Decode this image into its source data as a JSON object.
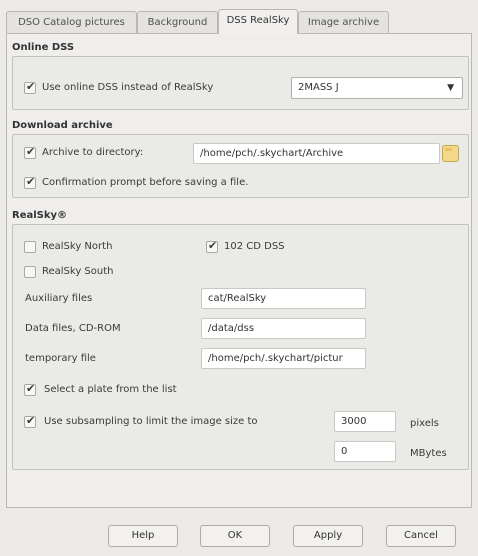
{
  "tabs": [
    {
      "label": "DSO Catalog pictures"
    },
    {
      "label": "Background"
    },
    {
      "label": "DSS RealSky"
    },
    {
      "label": "Image archive"
    }
  ],
  "online_dss": {
    "title": "Online DSS",
    "use_online_label": "Use online DSS instead of RealSky",
    "use_online_checked": true,
    "survey_selected": "2MASS J"
  },
  "download_archive": {
    "title": "Download archive",
    "archive_label": "Archive to directory:",
    "archive_checked": true,
    "archive_path": "/home/pch/.skychart/Archive",
    "confirm_label": "Confirmation prompt before saving a file.",
    "confirm_checked": true
  },
  "realsky": {
    "title": "RealSky®",
    "north_label": "RealSky North",
    "north_checked": false,
    "south_label": "RealSky South",
    "south_checked": false,
    "dss102_label": "102 CD DSS",
    "dss102_checked": true,
    "aux_label": "Auxiliary files",
    "aux_value": "cat/RealSky",
    "data_label": "Data files, CD-ROM",
    "data_value": "/data/dss",
    "temp_label": "temporary file",
    "temp_value": "/home/pch/.skychart/pictur",
    "plate_label": "Select a plate from the list",
    "plate_checked": true,
    "subsample_label": "Use subsampling to limit the image size to",
    "subsample_checked": true,
    "pixels_value": "3000",
    "pixels_unit": "pixels",
    "mbytes_value": "0",
    "mbytes_unit": "MBytes"
  },
  "buttons": {
    "help": "Help",
    "ok": "OK",
    "apply": "Apply",
    "cancel": "Cancel"
  },
  "icons": {
    "checkmark": "✔",
    "dropdown": "chevron-down-icon",
    "folder": "folder-icon"
  }
}
